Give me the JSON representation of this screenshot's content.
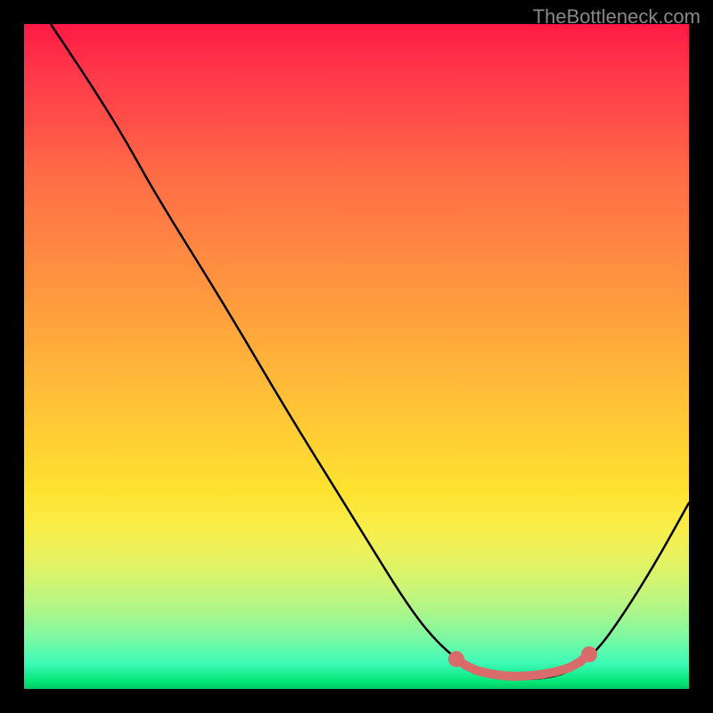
{
  "watermark": "TheBottleneck.com",
  "chart_data": {
    "type": "line",
    "title": "",
    "xlabel": "",
    "ylabel": "",
    "xlim": [
      0,
      100
    ],
    "ylim": [
      0,
      100
    ],
    "curve_points": [
      {
        "x": 4,
        "y": 100
      },
      {
        "x": 6,
        "y": 97
      },
      {
        "x": 10,
        "y": 91
      },
      {
        "x": 15,
        "y": 83
      },
      {
        "x": 20,
        "y": 74
      },
      {
        "x": 30,
        "y": 58
      },
      {
        "x": 40,
        "y": 41
      },
      {
        "x": 50,
        "y": 25
      },
      {
        "x": 58,
        "y": 12
      },
      {
        "x": 63,
        "y": 6
      },
      {
        "x": 68,
        "y": 2.5
      },
      {
        "x": 73,
        "y": 1.5
      },
      {
        "x": 78,
        "y": 1.5
      },
      {
        "x": 82,
        "y": 2.5
      },
      {
        "x": 86,
        "y": 5.5
      },
      {
        "x": 90,
        "y": 11
      },
      {
        "x": 95,
        "y": 19
      },
      {
        "x": 100,
        "y": 28
      }
    ],
    "trough_markers": [
      {
        "x": 65,
        "y": 4.5
      },
      {
        "x": 66.5,
        "y": 3.5
      },
      {
        "x": 68,
        "y": 2.8
      },
      {
        "x": 70,
        "y": 2.3
      },
      {
        "x": 72,
        "y": 2.0
      },
      {
        "x": 74,
        "y": 1.9
      },
      {
        "x": 76,
        "y": 2.0
      },
      {
        "x": 78,
        "y": 2.2
      },
      {
        "x": 80,
        "y": 2.6
      },
      {
        "x": 82,
        "y": 3.2
      },
      {
        "x": 83.5,
        "y": 4.0
      },
      {
        "x": 85,
        "y": 5.2
      }
    ],
    "colors": {
      "gradient_top": "#ff1a44",
      "gradient_bottom": "#00c864",
      "curve": "#000000",
      "markers": "#d96b6b",
      "background": "#000000"
    }
  }
}
